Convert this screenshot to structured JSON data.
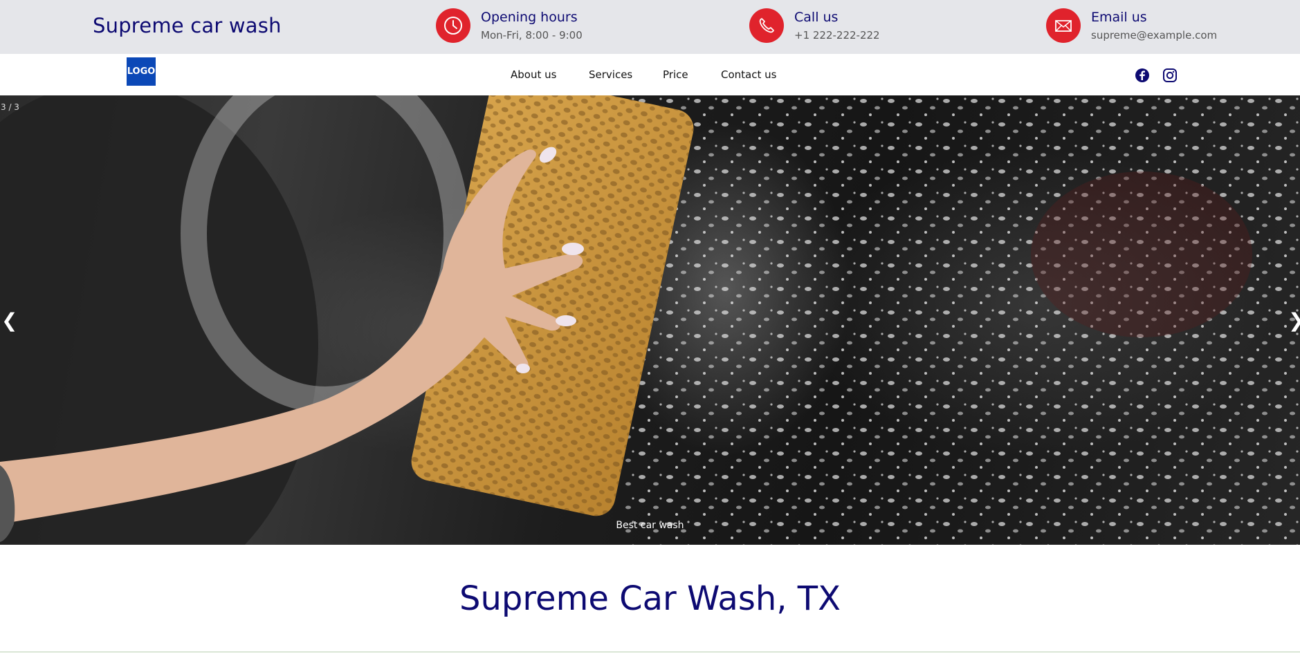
{
  "brand": "Supreme car wash",
  "info": {
    "hours": {
      "title": "Opening hours",
      "value": "Mon-Fri, 8:00 - 9:00",
      "icon": "clock-icon"
    },
    "call": {
      "title": "Call us",
      "value": "+1 222-222-222",
      "icon": "phone-icon"
    },
    "email": {
      "title": "Email us",
      "value": "supreme@example.com",
      "icon": "envelope-icon"
    }
  },
  "nav": {
    "logo": "LOGO",
    "links": [
      "About us",
      "Services",
      "Price",
      "Contact us"
    ],
    "social": [
      "facebook-icon",
      "instagram-icon"
    ]
  },
  "hero": {
    "counter": "3 / 3",
    "prev": "❮",
    "next": "❯",
    "caption": "Best car wash"
  },
  "headline": "Supreme Car Wash, TX",
  "colors": {
    "accent": "#e0232c",
    "brand": "#0d0a72",
    "topbar": "#e5e6ea",
    "logo": "#0b48b7"
  }
}
